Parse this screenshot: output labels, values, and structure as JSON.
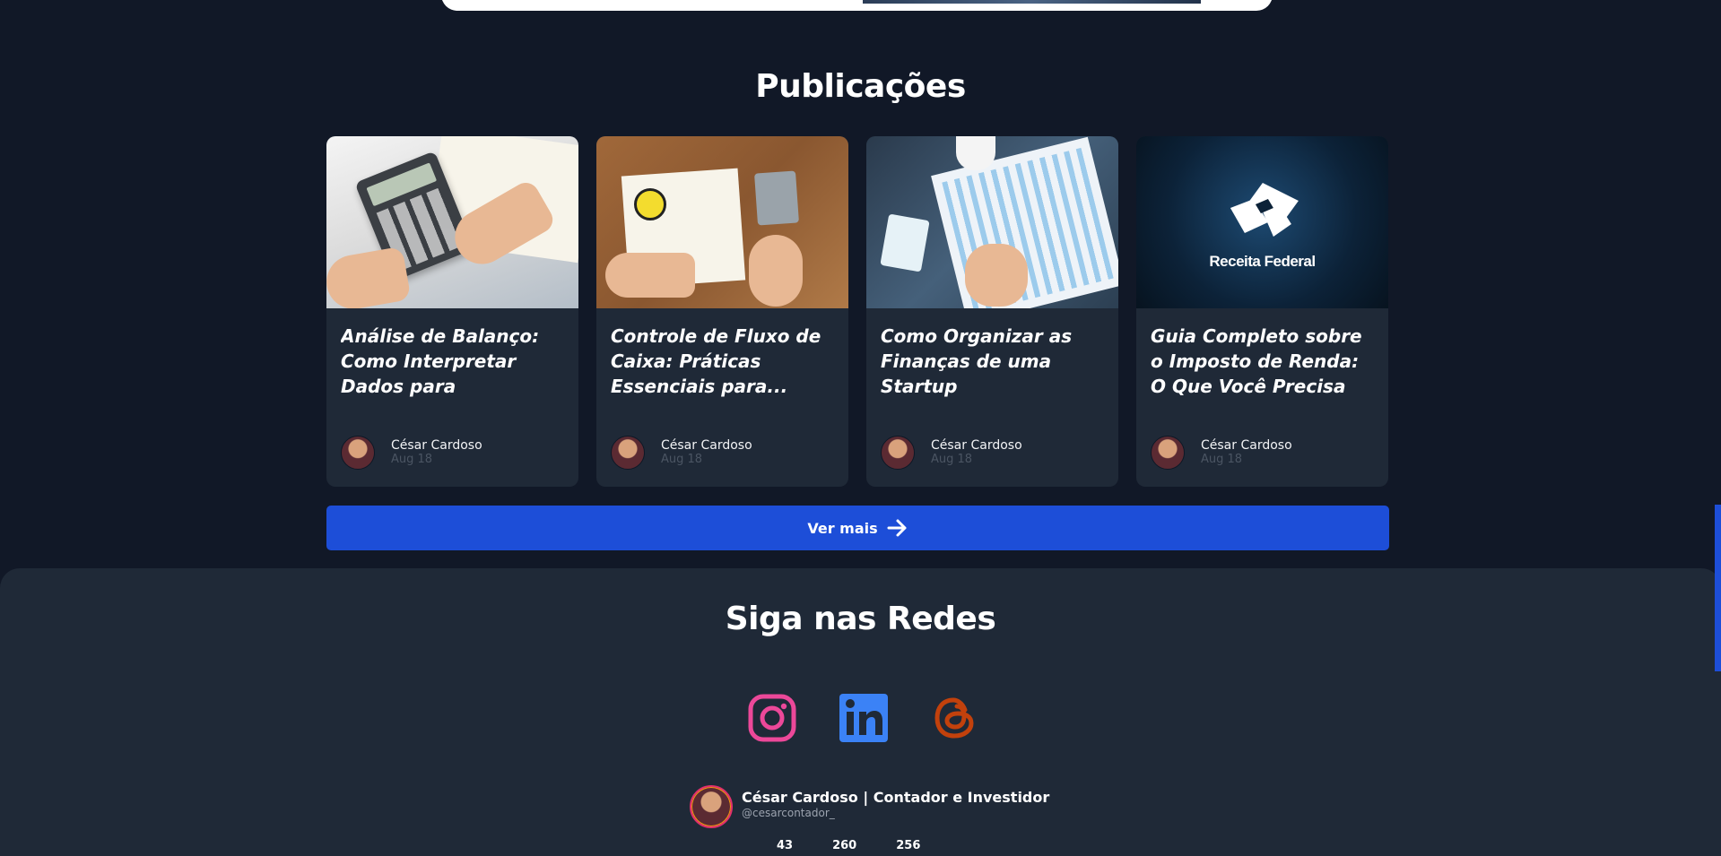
{
  "publications": {
    "title": "Publicações",
    "cards": [
      {
        "title": "Análise de Balanço: Como Interpretar Dados para Decisões...",
        "author": "César Cardoso",
        "date": "Aug 18",
        "image": "calculator-photo"
      },
      {
        "title": "Controle de Fluxo de Caixa: Práticas Essenciais para...",
        "author": "César Cardoso",
        "date": "Aug 18",
        "image": "notebook-lightbulb-photo"
      },
      {
        "title": "Como Organizar as Finanças de uma Startup",
        "author": "César Cardoso",
        "date": "Aug 18",
        "image": "financial-charts-photo"
      },
      {
        "title": "Guia Completo sobre o Imposto de Renda: O Que Você Precisa Saber",
        "author": "César Cardoso",
        "date": "Aug 18",
        "image": "receita-federal-logo",
        "image_text": "Receita Federal"
      }
    ],
    "more_button": "Ver mais"
  },
  "social": {
    "title": "Siga nas Redes",
    "icons": [
      "instagram-icon",
      "linkedin-icon",
      "threads-icon"
    ],
    "colors": {
      "instagram": "#ec4899",
      "linkedin": "#3b82f6",
      "threads": "#c2410c"
    }
  },
  "profile": {
    "name": "César Cardoso | Contador e Investidor",
    "handle": "@cesarcontador_",
    "stats": [
      "43",
      "260",
      "256"
    ]
  },
  "colors": {
    "background": "#111827",
    "card": "#1f2937",
    "accent": "#1d4ed8"
  }
}
